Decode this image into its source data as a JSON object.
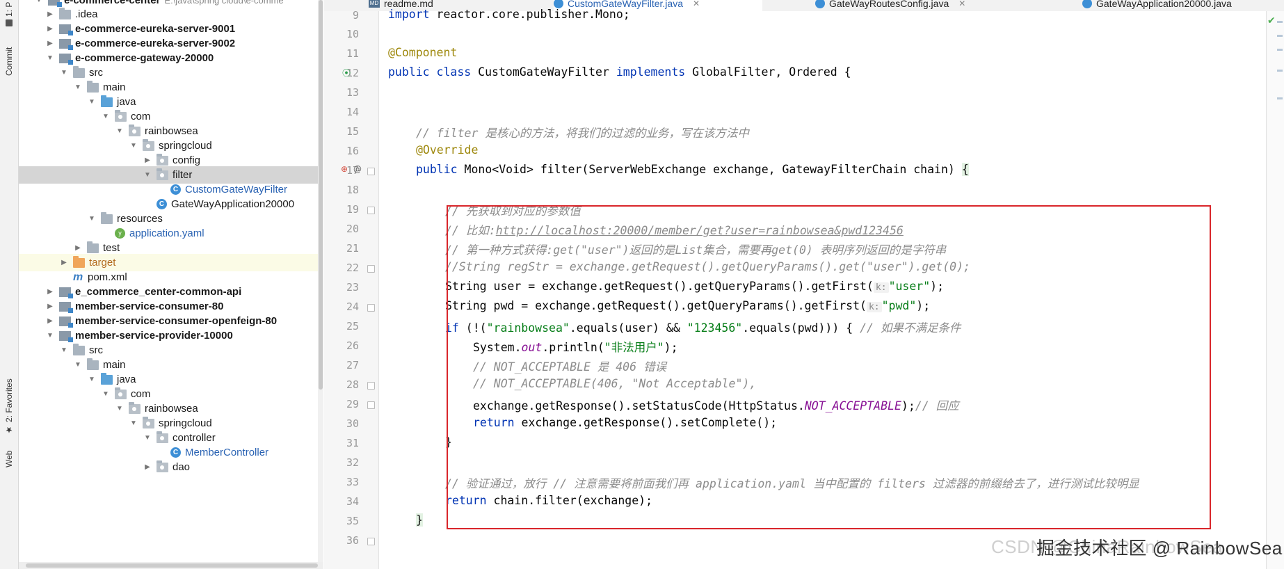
{
  "toolstrip": {
    "project_tab": "1: P",
    "commit_tab": "Commit",
    "favorites_tab": "2: Favorites",
    "web_tab": "Web"
  },
  "tabs": [
    {
      "label": "readme.md",
      "icon": "markdown-icon"
    },
    {
      "label": "CustomGateWayFilter.java",
      "icon": "class-icon",
      "active": true
    },
    {
      "label": "GateWayRoutesConfig.java",
      "icon": "class-icon"
    },
    {
      "label": "GateWayApplication20000.java",
      "icon": "class-icon"
    }
  ],
  "tree": {
    "root_label": "e-commerce-center",
    "root_path": "E:\\java\\spring cloud\\e-comme",
    "items": [
      {
        "label": ".idea"
      },
      {
        "label": "e-commerce-eureka-server-9001"
      },
      {
        "label": "e-commerce-eureka-server-9002"
      },
      {
        "label": "e-commerce-gateway-20000"
      },
      {
        "label": "src"
      },
      {
        "label": "main"
      },
      {
        "label": "java"
      },
      {
        "label": "com"
      },
      {
        "label": "rainbowsea"
      },
      {
        "label": "springcloud"
      },
      {
        "label": "config"
      },
      {
        "label": "filter"
      },
      {
        "label": "CustomGateWayFilter"
      },
      {
        "label": "GateWayApplication20000"
      },
      {
        "label": "resources"
      },
      {
        "label": "application.yaml"
      },
      {
        "label": "test"
      },
      {
        "label": "target"
      },
      {
        "label": "pom.xml"
      },
      {
        "label": "e_commerce_center-common-api"
      },
      {
        "label": "member-service-consumer-80"
      },
      {
        "label": "member-service-consumer-openfeign-80"
      },
      {
        "label": "member-service-provider-10000"
      },
      {
        "label": "src"
      },
      {
        "label": "main"
      },
      {
        "label": "java"
      },
      {
        "label": "com"
      },
      {
        "label": "rainbowsea"
      },
      {
        "label": "springcloud"
      },
      {
        "label": "controller"
      },
      {
        "label": "MemberController"
      },
      {
        "label": "dao"
      }
    ]
  },
  "editor": {
    "line_numbers": [
      "9",
      "10",
      "11",
      "12",
      "13",
      "14",
      "15",
      "16",
      "17",
      "18",
      "19",
      "20",
      "21",
      "22",
      "23",
      "24",
      "25",
      "26",
      "27",
      "28",
      "29",
      "30",
      "31",
      "32",
      "33",
      "34",
      "35",
      "36"
    ],
    "code": {
      "l9a": "import",
      "l9b": " reactor.core.publisher.Mono;",
      "l11": "@Component",
      "l12a": "public class",
      "l12b": " CustomGateWayFilter ",
      "l12c": "implements",
      "l12d": " GlobalFilter, Ordered {",
      "l15": "// filter 是核心的方法，将我们的过滤的业务，写在该方法中",
      "l16": "@Override",
      "l17a": "public",
      "l17b": " Mono<Void> filter(ServerWebExchange exchange, GatewayFilterChain chain) ",
      "l17c": "{",
      "l19": "// 先获取到对应的参数值",
      "l20a": "// 比如:",
      "l20b": "http://localhost:20000/member/get?user=rainbowsea&pwd123456",
      "l21": "// 第一种方式获得:get(\"user\")返回的是List集合，需要再get(0) 表明序列返回的是字符串",
      "l22": "//String regStr = exchange.getRequest().getQueryParams().get(\"user\").get(0);",
      "l23a": "String user = exchange.getRequest().getQueryParams().getFirst(",
      "l23h": "k:",
      "l23s": "\"user\"",
      "l23e": ");",
      "l24a": "String pwd = exchange.getRequest().getQueryParams().getFirst(",
      "l24h": "k:",
      "l24s": "\"pwd\"",
      "l24e": ");",
      "l25a": "if",
      "l25b": " (!(",
      "l25s1": "\"rainbowsea\"",
      "l25c": ".equals(user) && ",
      "l25s2": "\"123456\"",
      "l25d": ".equals(pwd))) { ",
      "l25cm": "// 如果不满足条件",
      "l26a": "System.",
      "l26f": "out",
      "l26b": ".println(",
      "l26s": "\"非法用户\"",
      "l26e": ");",
      "l27": "// NOT_ACCEPTABLE 是 406 错误",
      "l28": "// NOT_ACCEPTABLE(406, \"Not Acceptable\"),",
      "l29a": "exchange.getResponse().setStatusCode(HttpStatus.",
      "l29f": "NOT_ACCEPTABLE",
      "l29b": ");",
      "l29cm": "// 回应",
      "l30a": "return",
      "l30b": " exchange.getResponse().setComplete();",
      "l31": "}",
      "l33": "// 验证通过，放行 // 注意需要将前面我们再 application.yaml 当中配置的 filters 过滤器的前缀给去了，进行测试比较明显",
      "l34a": "return",
      "l34b": " chain.filter(exchange);",
      "l35": "}"
    }
  },
  "watermark": {
    "csdn": "CSDN @ChinaRainbowSea",
    "text": "掘金技术社区 @ RainbowSea"
  },
  "colors": {
    "keyword": "#0033b3",
    "annotation": "#9e880d",
    "comment": "#8c8c8c",
    "string": "#067d17",
    "highlight_box": "#d9262b",
    "accent": "#4083c9"
  }
}
